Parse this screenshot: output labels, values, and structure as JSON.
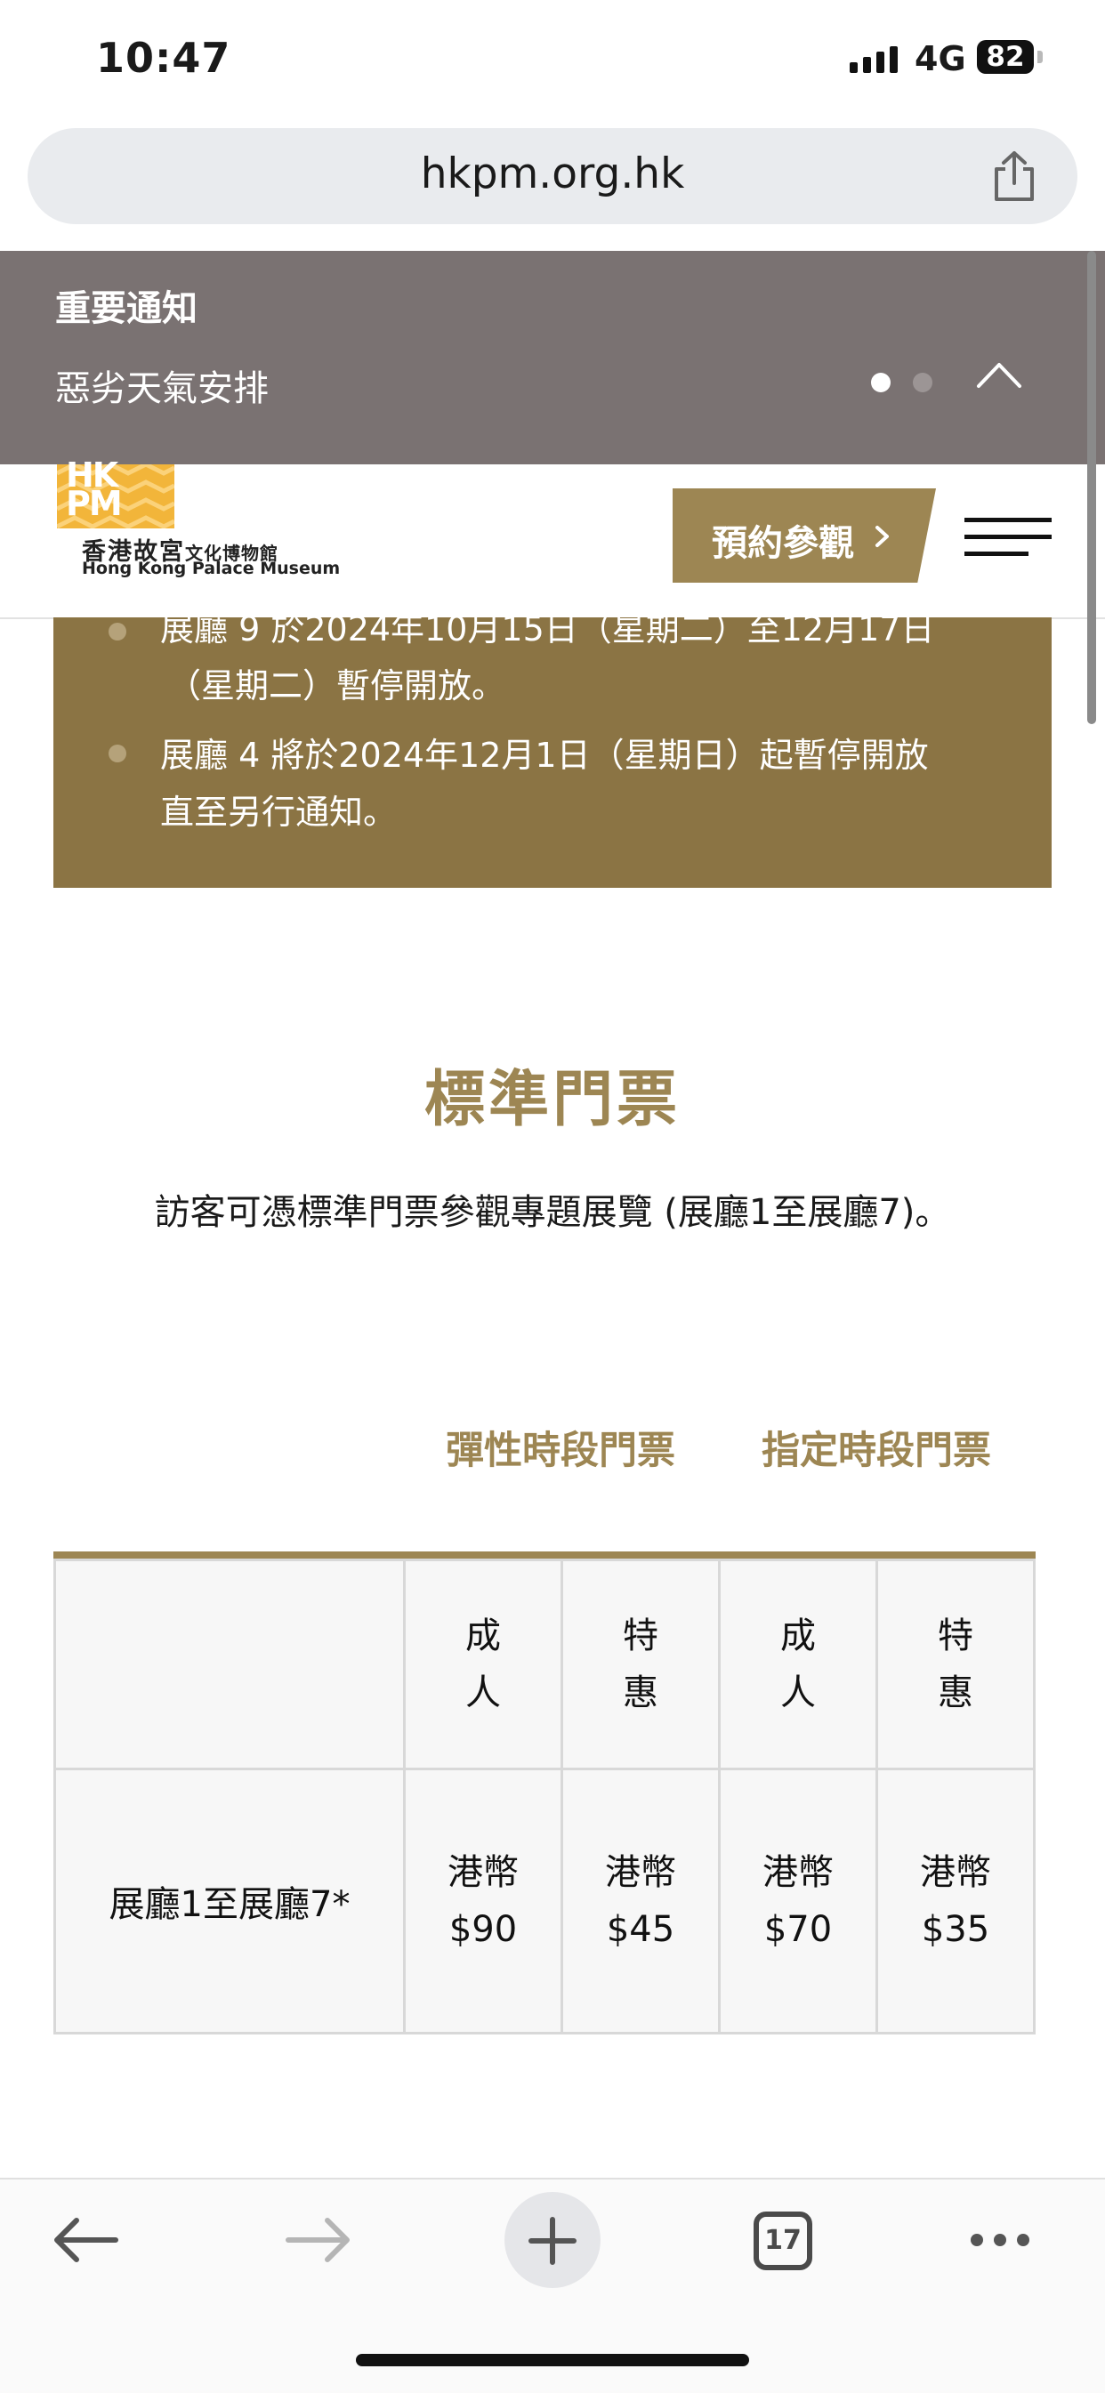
{
  "status_bar": {
    "time": "10:47",
    "network": "4G",
    "battery": "82"
  },
  "browser": {
    "url": "hkpm.org.hk",
    "open_tabs": "17"
  },
  "notice": {
    "title": "重要通知",
    "item": "惡劣天氣安排",
    "page_count": 2,
    "active_page": 1
  },
  "header": {
    "logo": {
      "letters": "HK\nPM",
      "zh_name": "香港故宮",
      "zh_small": "文化博物館",
      "en_name": "Hong Kong Palace Museum"
    },
    "book_button": "預約參觀"
  },
  "gallery_notices": [
    {
      "line1": "展廳 9 於2024年10月15日（星期二）至12月17日",
      "line2": "（星期二）暫停開放。"
    },
    {
      "line1": "展廳 4 將於2024年12月1日（星期日）起暫停開放",
      "line2": "直至另行通知。"
    }
  ],
  "tickets": {
    "title": "標準門票",
    "description": "訪客可憑標準門票參觀專題展覽 (展廳1至展廳7)。",
    "groups": [
      "彈性時段門票",
      "指定時段門票"
    ],
    "columns": [
      "成人",
      "特惠",
      "成人",
      "特惠"
    ],
    "rows": [
      {
        "label": "展廳1至展廳7*",
        "prices": [
          "港幣$90",
          "港幣$45",
          "港幣$70",
          "港幣$35"
        ]
      }
    ]
  }
}
